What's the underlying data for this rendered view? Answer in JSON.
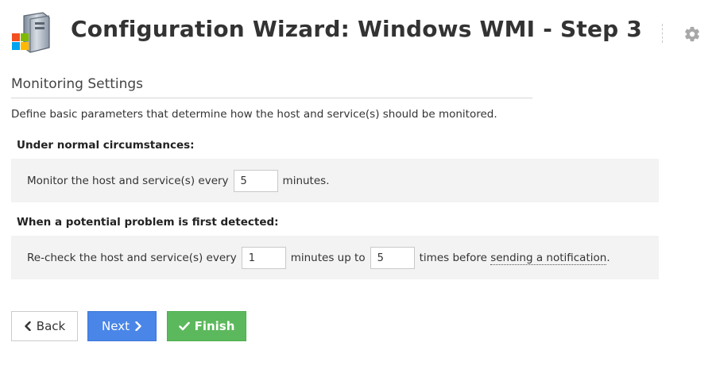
{
  "header": {
    "title": "Configuration Wizard: Windows WMI - Step 3"
  },
  "section": {
    "title": "Monitoring Settings",
    "description": "Define basic parameters that determine how the host and service(s) should be monitored."
  },
  "normal": {
    "heading": "Under normal circumstances:",
    "text_before": "Monitor the host and service(s) every",
    "interval_value": "5",
    "text_after": "minutes."
  },
  "problem": {
    "heading": "When a potential problem is first detected:",
    "text_before": "Re-check the host and service(s) every",
    "retry_interval_value": "1",
    "text_middle": "minutes up to",
    "max_attempts_value": "5",
    "text_after_1": "times before",
    "link_text": "sending a notification",
    "text_after_2": "."
  },
  "buttons": {
    "back_label": "Back",
    "next_label": "Next",
    "finish_label": "Finish"
  },
  "colors": {
    "next_bg": "#4a86e8",
    "finish_bg": "#5cb85c",
    "panel_bg": "#f3f3f3"
  },
  "icons": {
    "logo": "windows-server-icon",
    "settings": "gear-icon",
    "back": "chevron-left-icon",
    "next": "chevron-right-icon",
    "finish": "checkmark-icon"
  }
}
